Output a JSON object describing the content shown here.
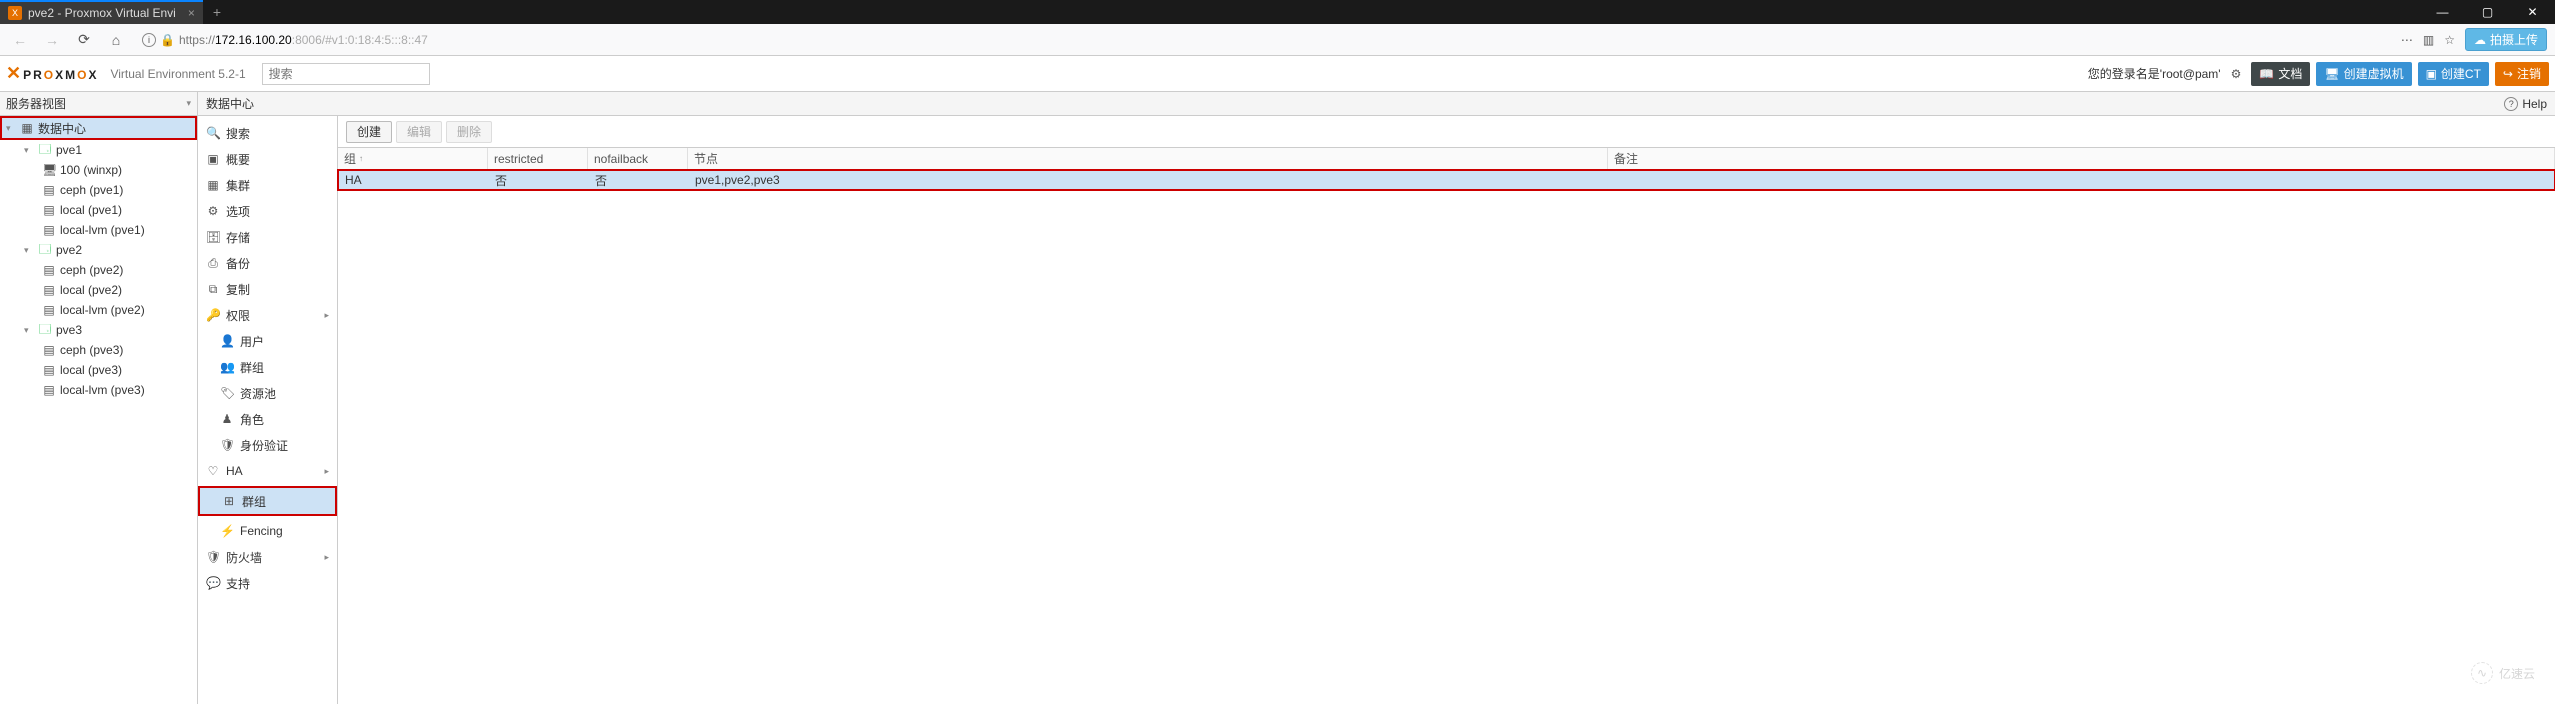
{
  "browser": {
    "tab_title": "pve2 - Proxmox Virtual Envi",
    "new_tab_glyph": "+",
    "tab_close": "×",
    "nav": {
      "back": "←",
      "forward": "→",
      "reload": "⟳",
      "home": "⌂"
    },
    "url_lock": "🔒",
    "url_https": "https://",
    "url_host": "172.16.100.20",
    "url_port_path": ":8006/#v1:0:18:4:5:::8::47",
    "menu": "⋯",
    "library": "▥",
    "bookmark": "☆",
    "upload_label": "拍摄上传"
  },
  "header": {
    "logo_mark": "✕",
    "logo_P": "PR",
    "logo_O1": "O",
    "logo_X": "XM",
    "logo_O2": "O",
    "logo_X2": "X",
    "version": "Virtual Environment 5.2-1",
    "search_placeholder": "搜索",
    "login": "您的登录名是'root@pam'",
    "gear": "⚙",
    "docs": "文档",
    "create_vm": "创建虚拟机",
    "create_ct": "创建CT",
    "logout": "注销"
  },
  "tree": {
    "header": "服务器视图",
    "datacenter": "数据中心",
    "nodes": [
      {
        "name": "pve1",
        "children": [
          {
            "icon": "🖥",
            "label": "100 (winxp)"
          },
          {
            "icon": "▤",
            "label": "ceph (pve1)"
          },
          {
            "icon": "▤",
            "label": "local (pve1)"
          },
          {
            "icon": "▤",
            "label": "local-lvm (pve1)"
          }
        ]
      },
      {
        "name": "pve2",
        "children": [
          {
            "icon": "▤",
            "label": "ceph (pve2)"
          },
          {
            "icon": "▤",
            "label": "local (pve2)"
          },
          {
            "icon": "▤",
            "label": "local-lvm (pve2)"
          }
        ]
      },
      {
        "name": "pve3",
        "children": [
          {
            "icon": "▤",
            "label": "ceph (pve3)"
          },
          {
            "icon": "▤",
            "label": "local (pve3)"
          },
          {
            "icon": "▤",
            "label": "local-lvm (pve3)"
          }
        ]
      }
    ]
  },
  "content": {
    "header": "数据中心",
    "help": "Help"
  },
  "sidemenu": {
    "items": [
      {
        "icon": "🔍",
        "label": "搜索"
      },
      {
        "icon": "▣",
        "label": "概要"
      },
      {
        "icon": "▦",
        "label": "集群"
      },
      {
        "icon": "⚙",
        "label": "选项"
      },
      {
        "icon": "🗄",
        "label": "存储"
      },
      {
        "icon": "⎙",
        "label": "备份"
      },
      {
        "icon": "⧉",
        "label": "复制"
      },
      {
        "icon": "🔑",
        "label": "权限",
        "expandable": true,
        "expanded": true,
        "subs": [
          {
            "icon": "👤",
            "label": "用户"
          },
          {
            "icon": "👥",
            "label": "群组"
          },
          {
            "icon": "🏷",
            "label": "资源池"
          },
          {
            "icon": "♟",
            "label": "角色"
          },
          {
            "icon": "🛡",
            "label": "身份验证"
          }
        ]
      },
      {
        "icon": "♡",
        "label": "HA",
        "expandable": true,
        "expanded": true,
        "subs": [
          {
            "icon": "⊞",
            "label": "群组",
            "selected": true
          },
          {
            "icon": "⚡",
            "label": "Fencing"
          }
        ]
      },
      {
        "icon": "🛡",
        "label": "防火墙",
        "expandable": true
      },
      {
        "icon": "💬",
        "label": "支持"
      }
    ]
  },
  "grid": {
    "toolbar": {
      "create": "创建",
      "edit": "编辑",
      "remove": "删除"
    },
    "columns": {
      "group": "组",
      "restricted": "restricted",
      "nofailback": "nofailback",
      "nodes": "节点",
      "comment": "备注"
    },
    "row": {
      "group": "HA",
      "restricted": "否",
      "nofailback": "否",
      "nodes": "pve1,pve2,pve3",
      "comment": ""
    }
  },
  "watermark": "亿速云"
}
